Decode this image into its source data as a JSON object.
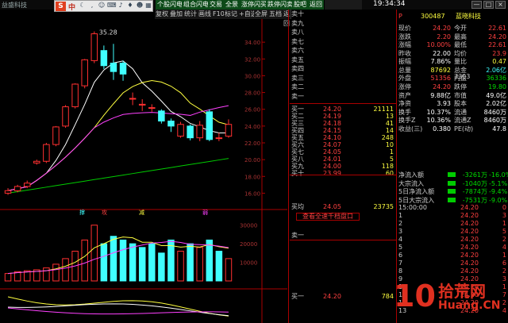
{
  "app": {
    "title": "益盛科技"
  },
  "sogou": {
    "lang": "中"
  },
  "menu": [
    "个股闪电",
    "组合闪电",
    "交易",
    "全景",
    "涨停闪买",
    "跌停闪卖",
    "股吧",
    "返回"
  ],
  "toolbar": [
    "复权",
    "叠加",
    "统计",
    "画线",
    "F10",
    "标记",
    "+自选",
    "全屏",
    "五档",
    "返回"
  ],
  "clock": "19:34:34",
  "window_buttons": [
    "—",
    "□",
    "×"
  ],
  "kline": {
    "high_label": "35.28",
    "y_ticks": [
      "34.00",
      "32.00",
      "30.00",
      "28.00",
      "26.00",
      "24.00",
      "22.00",
      "20.00",
      "18.00",
      "16.00"
    ],
    "vol_ticks": [
      "30000",
      "20000",
      "10000"
    ],
    "signal_labels": [
      "撑",
      "攻",
      "减",
      "弱"
    ],
    "candles": [
      {
        "o": 16.0,
        "c": 16.3,
        "h": 16.6,
        "l": 15.8
      },
      {
        "o": 16.3,
        "c": 16.8,
        "h": 17.0,
        "l": 16.1
      },
      {
        "o": 16.8,
        "c": 17.2,
        "h": 17.5,
        "l": 16.6
      },
      {
        "o": 19.6,
        "c": 19.8,
        "h": 20.0,
        "l": 19.4
      },
      {
        "o": 19.8,
        "c": 21.8,
        "h": 22.0,
        "l": 19.6
      },
      {
        "o": 21.8,
        "c": 23.9,
        "h": 24.0,
        "l": 21.6
      },
      {
        "o": 24.0,
        "c": 26.3,
        "h": 26.5,
        "l": 23.8
      },
      {
        "o": 26.3,
        "c": 29.0,
        "h": 29.1,
        "l": 26.1
      },
      {
        "o": 28.8,
        "c": 31.9,
        "h": 32.0,
        "l": 28.5
      },
      {
        "o": 31.8,
        "c": 35.0,
        "h": 35.28,
        "l": 31.5
      },
      {
        "o": 33.0,
        "c": 31.2,
        "h": 33.6,
        "l": 30.8
      },
      {
        "o": 31.5,
        "c": 30.5,
        "h": 33.8,
        "l": 29.5
      },
      {
        "o": 31.5,
        "c": 30.2,
        "h": 31.8,
        "l": 29.4
      },
      {
        "o": 27.3,
        "c": 27.3,
        "h": 28.0,
        "l": 26.5
      },
      {
        "o": 26.5,
        "c": 26.6,
        "h": 27.2,
        "l": 25.8
      },
      {
        "o": 26.2,
        "c": 26.2,
        "h": 26.6,
        "l": 25.7
      },
      {
        "o": 25.8,
        "c": 24.6,
        "h": 26.0,
        "l": 24.3
      },
      {
        "o": 24.6,
        "c": 24.0,
        "h": 24.9,
        "l": 23.3
      },
      {
        "o": 22.8,
        "c": 24.2,
        "h": 24.5,
        "l": 22.6
      },
      {
        "o": 24.0,
        "c": 22.6,
        "h": 24.2,
        "l": 22.3
      },
      {
        "o": 22.6,
        "c": 24.1,
        "h": 24.6,
        "l": 22.2
      },
      {
        "o": 25.7,
        "c": 22.4,
        "h": 26.0,
        "l": 22.2
      },
      {
        "o": 22.6,
        "c": 22.6,
        "h": 23.2,
        "l": 22.2
      },
      {
        "o": 22.8,
        "c": 24.2,
        "h": 24.8,
        "l": 22.6
      }
    ],
    "volumes": [
      4000,
      5000,
      5500,
      6000,
      7000,
      9000,
      12000,
      16000,
      22000,
      30000,
      20000,
      24000,
      22000,
      20000,
      18000,
      20000,
      15000,
      22000,
      16000,
      20000,
      18000,
      22000,
      16000,
      12000
    ],
    "vol_up": [
      true,
      true,
      true,
      true,
      true,
      true,
      true,
      true,
      true,
      true,
      false,
      false,
      false,
      false,
      false,
      false,
      false,
      false,
      true,
      false,
      true,
      false,
      false,
      true
    ]
  },
  "order_book": {
    "asks": [
      {
        "label": "卖十",
        "price": "",
        "vol": ""
      },
      {
        "label": "卖九",
        "price": "",
        "vol": ""
      },
      {
        "label": "卖八",
        "price": "",
        "vol": ""
      },
      {
        "label": "卖七",
        "price": "",
        "vol": ""
      },
      {
        "label": "卖六",
        "price": "",
        "vol": ""
      },
      {
        "label": "卖五",
        "price": "",
        "vol": ""
      },
      {
        "label": "卖四",
        "price": "",
        "vol": ""
      },
      {
        "label": "卖三",
        "price": "",
        "vol": ""
      },
      {
        "label": "卖二",
        "price": "",
        "vol": ""
      },
      {
        "label": "卖一",
        "price": "",
        "vol": ""
      }
    ],
    "bids": [
      {
        "label": "买一",
        "price": "24.20",
        "vol": "21111"
      },
      {
        "label": "买二",
        "price": "24.19",
        "vol": "13"
      },
      {
        "label": "买三",
        "price": "24.18",
        "vol": "41"
      },
      {
        "label": "买四",
        "price": "24.15",
        "vol": "14"
      },
      {
        "label": "买五",
        "price": "24.10",
        "vol": "248"
      },
      {
        "label": "买六",
        "price": "24.07",
        "vol": "10"
      },
      {
        "label": "买七",
        "price": "24.05",
        "vol": "1"
      },
      {
        "label": "买八",
        "price": "24.01",
        "vol": "5"
      },
      {
        "label": "买九",
        "price": "24.00",
        "vol": "118"
      },
      {
        "label": "买十",
        "price": "23.99",
        "vol": "60"
      }
    ],
    "avg_label": "买均",
    "avg_price": "24.05",
    "avg_vol": "23735",
    "view_link": "查看全速千档盘口",
    "sell_one_label": "卖一",
    "bottom_label": "买一",
    "bottom_price": "24.20",
    "bottom_vol": "784"
  },
  "stock": {
    "market": "P",
    "code": "300487",
    "name": "蓝晓科技",
    "rows": [
      {
        "l1": "现价",
        "v1": "24.20",
        "l2": "今开",
        "v2": "22.61",
        "c1": "red",
        "c2": "red"
      },
      {
        "l1": "涨跌",
        "v1": "2.20",
        "l2": "最高",
        "v2": "24.20",
        "c1": "red",
        "c2": "red"
      },
      {
        "l1": "涨幅",
        "v1": "10.00%",
        "l2": "最低",
        "v2": "22.61",
        "c1": "red",
        "c2": "red"
      },
      {
        "l1": "昨收",
        "v1": "22.00",
        "l2": "均价",
        "v2": "23.9",
        "c1": "white",
        "c2": "red"
      },
      {
        "l1": "振幅",
        "v1": "7.86%",
        "l2": "量比",
        "v2": "0.47",
        "c1": "white",
        "c2": "yellow"
      },
      {
        "l1": "总量",
        "v1": "87692",
        "l2": "总金",
        "v2": "2.06亿",
        "c1": "yellow",
        "c2": "cyan"
      },
      {
        "l1": "外盘",
        "v1": "51356",
        "l2": "内盘",
        "v2": "36336",
        "c1": "red",
        "c2": "green"
      },
      {
        "l1": "涨停",
        "v1": "24.20",
        "l2": "跌停",
        "v2": "19.80",
        "c1": "red",
        "c2": "green"
      },
      {
        "l1": "资产",
        "v1": "9.88亿",
        "l2": "市值",
        "v2": "49.0亿",
        "c1": "white",
        "c2": "white"
      },
      {
        "l1": "净资",
        "v1": "3.93",
        "l2": "股本",
        "v2": "2.02亿",
        "c1": "white",
        "c2": "white"
      },
      {
        "l1": "换手",
        "v1": "10.37%",
        "l2": "流通",
        "v2": "8460万",
        "c1": "white",
        "c2": "white"
      },
      {
        "l1": "换手Z",
        "v1": "10.36%",
        "l2": "流通Z",
        "v2": "8460万",
        "c1": "white",
        "c2": "white"
      },
      {
        "l1": "收益(三)",
        "v1": "0.380",
        "l2": "PE(动)",
        "v2": "47.8",
        "c1": "white",
        "c2": "white"
      }
    ],
    "flows": [
      {
        "label": "净流入额",
        "value": "-3261万",
        "pct": "-16.0%"
      },
      {
        "label": "大宗流入",
        "value": "-1040万",
        "pct": "-5.1%"
      },
      {
        "label": "5日净流入额",
        "value": "-7874万",
        "pct": "-9.4%"
      },
      {
        "label": "5日大宗流入",
        "value": "-7531万",
        "pct": "-9.0%"
      }
    ],
    "extra_vol": "7303"
  },
  "ticks": [
    {
      "t": "15:00:00",
      "p": "24.20",
      "v": "0"
    },
    {
      "t": "1",
      "p": "24.20",
      "v": "3"
    },
    {
      "t": "2",
      "p": "24.20",
      "v": "1"
    },
    {
      "t": "3",
      "p": "24.20",
      "v": "5"
    },
    {
      "t": "4",
      "p": "24.20",
      "v": "2"
    },
    {
      "t": "5",
      "p": "24.20",
      "v": "4"
    },
    {
      "t": "6",
      "p": "24.20",
      "v": "1"
    },
    {
      "t": "7",
      "p": "24.20",
      "v": "6"
    },
    {
      "t": "8",
      "p": "24.20",
      "v": "2"
    },
    {
      "t": "9",
      "p": "24.20",
      "v": "3"
    },
    {
      "t": "10",
      "p": "24.20",
      "v": "1"
    },
    {
      "t": "11",
      "p": "24.20",
      "v": "7"
    },
    {
      "t": "12",
      "p": "24.20",
      "v": "2"
    },
    {
      "t": "13",
      "p": "24.20",
      "v": "4"
    }
  ],
  "watermark": {
    "num": "10",
    "cn": "拾荒网",
    "url": "Huang.CN"
  },
  "colors": {
    "up": "#ff3030",
    "down": "#40ffff",
    "ma5": "#ffffff",
    "ma10": "#ffff40",
    "ma20": "#ff40ff",
    "ma60": "#00cc00"
  }
}
